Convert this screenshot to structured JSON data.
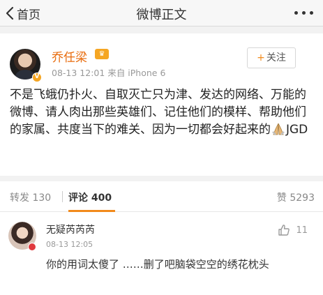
{
  "navbar": {
    "back_label": "首页",
    "title": "微博正文",
    "more_icon": "more-dots-icon"
  },
  "post": {
    "author": "乔任梁",
    "time": "08-13 12:01",
    "source": "来自 iPhone 6",
    "follow_label": "关注",
    "text_before_icon": "不是飞蛾仍扑火、自取灭亡只为津、发达的网络、万能的微博、请人肉出那些英雄们、记住他们的模样、帮助他们的家属、共度当下的难关、因为一切都会好起来的",
    "text_after_icon": "JGD",
    "inline_icon": "praying-hands-icon"
  },
  "stats": {
    "repost_label": "转发",
    "repost_count": "130",
    "comment_label": "评论",
    "comment_count": "400",
    "like_label": "赞",
    "like_count": "5293"
  },
  "comment": {
    "author": "无疑芮芮芮",
    "time": "08-13 12:05",
    "like_count": "11",
    "text": "你的用词太傻了 ……删了吧脑袋空空的绣花枕头"
  },
  "colors": {
    "accent": "#f28a1b",
    "author_name": "#e86b0c",
    "verified_badge": "#f5a623"
  }
}
